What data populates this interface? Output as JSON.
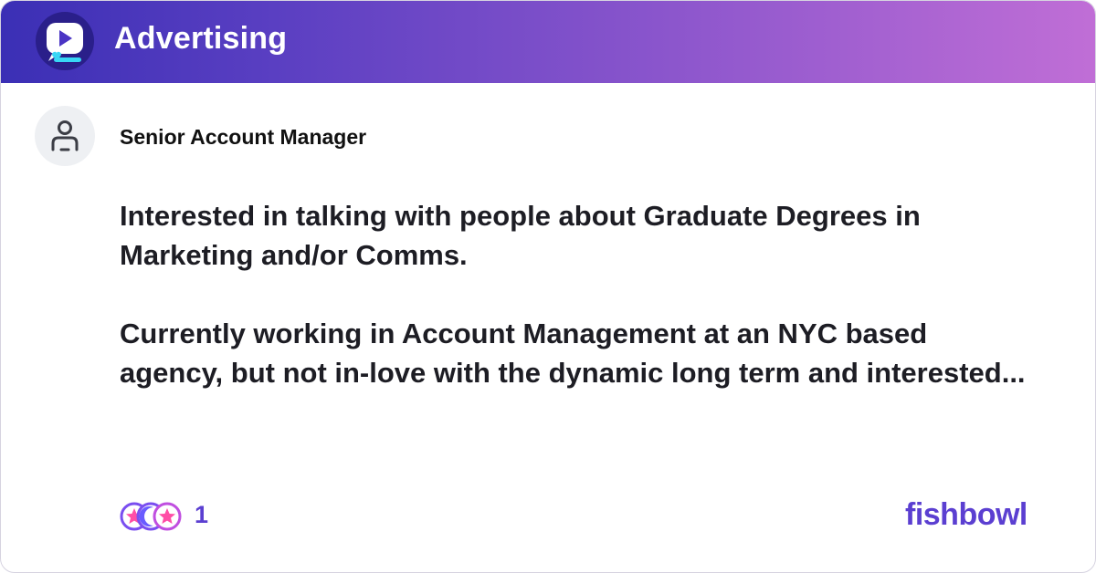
{
  "header": {
    "title": "Advertising",
    "gradient_start": "#3b2fb5",
    "gradient_end": "#c06ed6",
    "logo_icon": "video-chat-bubble-icon"
  },
  "post": {
    "author_title": "Senior Account Manager",
    "avatar_icon": "anonymous-user-icon",
    "line1": "Interested in talking with people about Graduate Degrees in",
    "line2": "Marketing and/or Comms.",
    "line3": "Currently working in Account Management at an NYC based",
    "line4": "agency, but not in-love with the dynamic long term and interested..."
  },
  "footer": {
    "reaction_icons": [
      "star-reaction-icon",
      "moon-reaction-icon",
      "star-reaction-icon"
    ],
    "reaction_count": "1",
    "brand": "fishbowl",
    "brand_color": "#5b3fd1"
  }
}
